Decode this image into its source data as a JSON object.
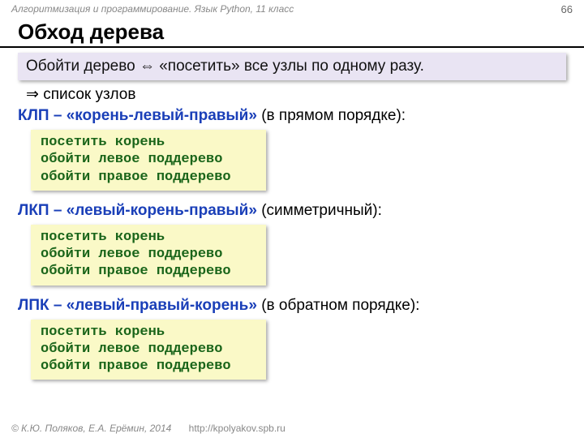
{
  "topbar": {
    "context": "Алгоритмизация и программирование. Язык Python, 11 класс",
    "page": "66"
  },
  "title": "Обход дерева",
  "band": "Обойти дерево ⇔ «посетить» все узлы по одному разу.",
  "subline_arrow": "⇒",
  "subline_text": "список узлов",
  "sections": [
    {
      "abbr": "КЛП",
      "dash": " – ",
      "desc": "«корень-левый-правый»",
      "par": " (в прямом порядке):",
      "code": [
        "посетить корень",
        "обойти левое поддерево",
        "обойти правое поддерево"
      ]
    },
    {
      "abbr": "ЛКП",
      "dash": " – ",
      "desc": "«левый-корень-правый»",
      "par": " (симметричный):",
      "code": [
        "посетить корень",
        "обойти левое поддерево",
        "обойти правое поддерево"
      ]
    },
    {
      "abbr": "ЛПК",
      "dash": " – ",
      "desc": "«левый-правый-корень»",
      "par": " (в обратном порядке):",
      "code": [
        "посетить корень",
        "обойти левое поддерево",
        "обойти правое поддерево"
      ]
    }
  ],
  "footer": {
    "copy": "© К.Ю. Поляков, Е.А. Ерёмин, 2014",
    "url": "http://kpolyakov.spb.ru"
  }
}
